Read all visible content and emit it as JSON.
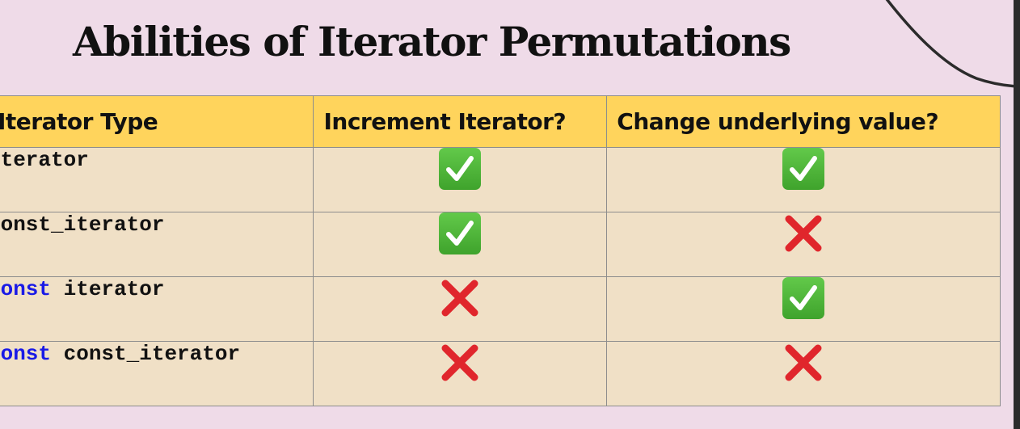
{
  "title": "Abilities of Iterator Permutations",
  "table": {
    "headers": [
      "Iterator Type",
      "Increment Iterator?",
      "Change underlying value?"
    ],
    "rows": [
      {
        "type_keyword": "",
        "type_name": "iterator",
        "increment": "check-icon",
        "change": "check-icon"
      },
      {
        "type_keyword": "",
        "type_name": "const_iterator",
        "increment": "check-icon",
        "change": "cross-icon"
      },
      {
        "type_keyword": "const",
        "type_name": " iterator",
        "increment": "cross-icon",
        "change": "check-icon"
      },
      {
        "type_keyword": "const",
        "type_name": " const_iterator",
        "increment": "cross-icon",
        "change": "cross-icon"
      }
    ]
  },
  "colors": {
    "background": "#efdbe8",
    "header": "#ffd45c",
    "cell": "#f0e0c6",
    "keyword": "#1a1ae6",
    "check": "#4cb536",
    "cross": "#e0262c"
  }
}
